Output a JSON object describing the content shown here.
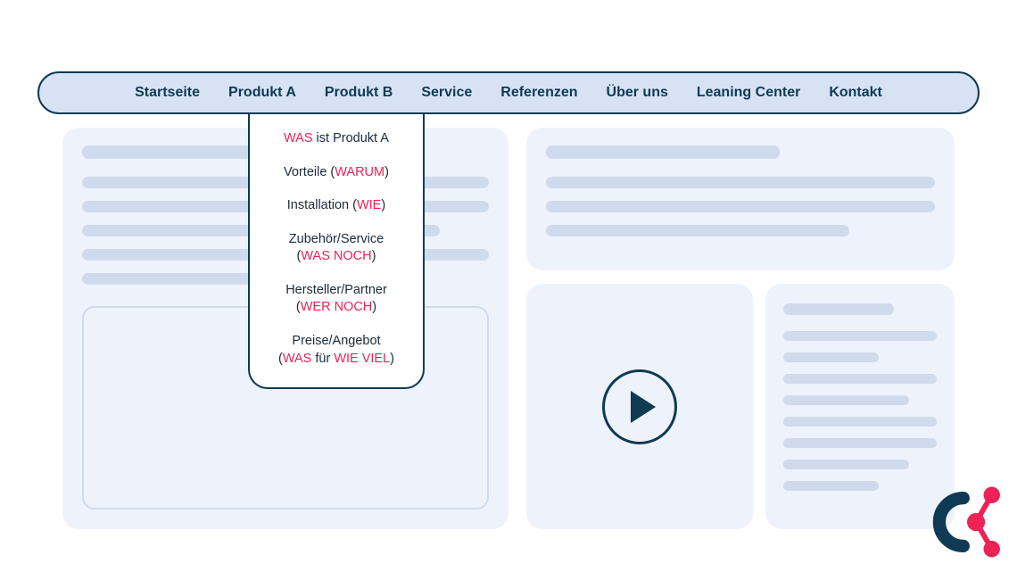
{
  "nav": {
    "items": [
      {
        "label": "Startseite"
      },
      {
        "label": "Produkt A"
      },
      {
        "label": "Produkt B"
      },
      {
        "label": "Service"
      },
      {
        "label": "Referenzen"
      },
      {
        "label": "Über uns"
      },
      {
        "label": "Leaning Center"
      },
      {
        "label": "Kontakt"
      }
    ]
  },
  "dropdown": {
    "items": [
      {
        "pre": "",
        "hl": "WAS",
        "mid": " ist Produkt A",
        "hl2": "",
        "post": ""
      },
      {
        "pre": "Vorteile (",
        "hl": "WARUM",
        "mid": "",
        "hl2": "",
        "post": ")"
      },
      {
        "pre": "Installation (",
        "hl": "WIE",
        "mid": "",
        "hl2": "",
        "post": ")"
      },
      {
        "pre": "Zubehör/Service\n(",
        "hl": "WAS NOCH",
        "mid": "",
        "hl2": "",
        "post": ")"
      },
      {
        "pre": "Hersteller/Partner\n(",
        "hl": "WER NOCH",
        "mid": "",
        "hl2": "",
        "post": ")"
      },
      {
        "pre": "Preise/Angebot\n(",
        "hl": "WAS",
        "mid": " für ",
        "hl2": "WIE VIEL",
        "post": ")"
      }
    ]
  },
  "colors": {
    "accent": "#ee2255",
    "dark": "#0e3a53",
    "panel": "#eef3fb",
    "skel": "#cfdbed",
    "navbg": "#d7e3f4"
  }
}
